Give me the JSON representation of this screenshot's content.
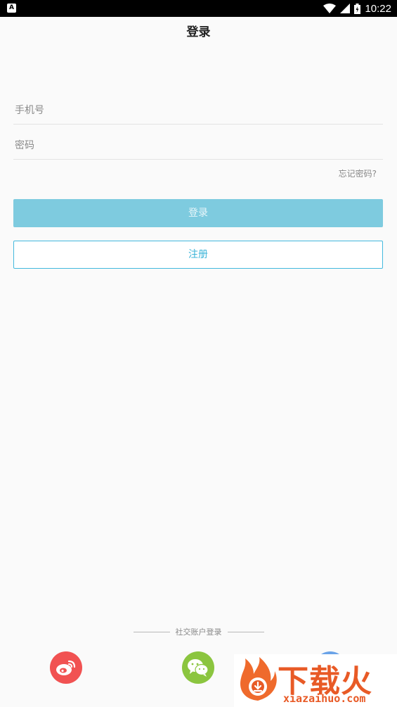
{
  "status_bar": {
    "app_badge": "A",
    "time": "10:22"
  },
  "header": {
    "title": "登录"
  },
  "form": {
    "phone_placeholder": "手机号",
    "password_placeholder": "密码",
    "forgot_label": "忘记密码?"
  },
  "buttons": {
    "login_label": "登录",
    "register_label": "注册"
  },
  "social": {
    "title": "社交账户登录",
    "providers": [
      "weibo-icon",
      "wechat-icon",
      "qq-icon"
    ]
  },
  "watermark": {
    "brand": "下载火",
    "url": "xiazaihuo.com"
  },
  "colors": {
    "login_button": "#7ecbdf",
    "register_border": "#43b9de",
    "weibo": "#f15252",
    "wechat": "#8bc53f",
    "qq": "#6aa3e8",
    "watermark": "#e85a26"
  }
}
